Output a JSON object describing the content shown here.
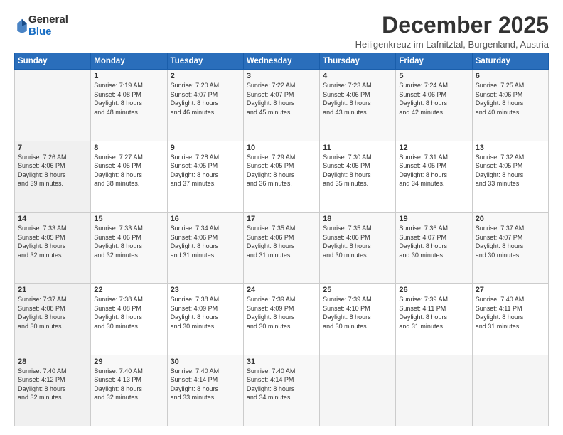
{
  "logo": {
    "general": "General",
    "blue": "Blue"
  },
  "header": {
    "month": "December 2025",
    "location": "Heiligenkreuz im Lafnitztal, Burgenland, Austria"
  },
  "weekdays": [
    "Sunday",
    "Monday",
    "Tuesday",
    "Wednesday",
    "Thursday",
    "Friday",
    "Saturday"
  ],
  "weeks": [
    [
      {
        "day": "",
        "info": ""
      },
      {
        "day": "1",
        "info": "Sunrise: 7:19 AM\nSunset: 4:08 PM\nDaylight: 8 hours\nand 48 minutes."
      },
      {
        "day": "2",
        "info": "Sunrise: 7:20 AM\nSunset: 4:07 PM\nDaylight: 8 hours\nand 46 minutes."
      },
      {
        "day": "3",
        "info": "Sunrise: 7:22 AM\nSunset: 4:07 PM\nDaylight: 8 hours\nand 45 minutes."
      },
      {
        "day": "4",
        "info": "Sunrise: 7:23 AM\nSunset: 4:06 PM\nDaylight: 8 hours\nand 43 minutes."
      },
      {
        "day": "5",
        "info": "Sunrise: 7:24 AM\nSunset: 4:06 PM\nDaylight: 8 hours\nand 42 minutes."
      },
      {
        "day": "6",
        "info": "Sunrise: 7:25 AM\nSunset: 4:06 PM\nDaylight: 8 hours\nand 40 minutes."
      }
    ],
    [
      {
        "day": "7",
        "info": "Sunrise: 7:26 AM\nSunset: 4:06 PM\nDaylight: 8 hours\nand 39 minutes."
      },
      {
        "day": "8",
        "info": "Sunrise: 7:27 AM\nSunset: 4:05 PM\nDaylight: 8 hours\nand 38 minutes."
      },
      {
        "day": "9",
        "info": "Sunrise: 7:28 AM\nSunset: 4:05 PM\nDaylight: 8 hours\nand 37 minutes."
      },
      {
        "day": "10",
        "info": "Sunrise: 7:29 AM\nSunset: 4:05 PM\nDaylight: 8 hours\nand 36 minutes."
      },
      {
        "day": "11",
        "info": "Sunrise: 7:30 AM\nSunset: 4:05 PM\nDaylight: 8 hours\nand 35 minutes."
      },
      {
        "day": "12",
        "info": "Sunrise: 7:31 AM\nSunset: 4:05 PM\nDaylight: 8 hours\nand 34 minutes."
      },
      {
        "day": "13",
        "info": "Sunrise: 7:32 AM\nSunset: 4:05 PM\nDaylight: 8 hours\nand 33 minutes."
      }
    ],
    [
      {
        "day": "14",
        "info": "Sunrise: 7:33 AM\nSunset: 4:05 PM\nDaylight: 8 hours\nand 32 minutes."
      },
      {
        "day": "15",
        "info": "Sunrise: 7:33 AM\nSunset: 4:06 PM\nDaylight: 8 hours\nand 32 minutes."
      },
      {
        "day": "16",
        "info": "Sunrise: 7:34 AM\nSunset: 4:06 PM\nDaylight: 8 hours\nand 31 minutes."
      },
      {
        "day": "17",
        "info": "Sunrise: 7:35 AM\nSunset: 4:06 PM\nDaylight: 8 hours\nand 31 minutes."
      },
      {
        "day": "18",
        "info": "Sunrise: 7:35 AM\nSunset: 4:06 PM\nDaylight: 8 hours\nand 30 minutes."
      },
      {
        "day": "19",
        "info": "Sunrise: 7:36 AM\nSunset: 4:07 PM\nDaylight: 8 hours\nand 30 minutes."
      },
      {
        "day": "20",
        "info": "Sunrise: 7:37 AM\nSunset: 4:07 PM\nDaylight: 8 hours\nand 30 minutes."
      }
    ],
    [
      {
        "day": "21",
        "info": "Sunrise: 7:37 AM\nSunset: 4:08 PM\nDaylight: 8 hours\nand 30 minutes."
      },
      {
        "day": "22",
        "info": "Sunrise: 7:38 AM\nSunset: 4:08 PM\nDaylight: 8 hours\nand 30 minutes."
      },
      {
        "day": "23",
        "info": "Sunrise: 7:38 AM\nSunset: 4:09 PM\nDaylight: 8 hours\nand 30 minutes."
      },
      {
        "day": "24",
        "info": "Sunrise: 7:39 AM\nSunset: 4:09 PM\nDaylight: 8 hours\nand 30 minutes."
      },
      {
        "day": "25",
        "info": "Sunrise: 7:39 AM\nSunset: 4:10 PM\nDaylight: 8 hours\nand 30 minutes."
      },
      {
        "day": "26",
        "info": "Sunrise: 7:39 AM\nSunset: 4:11 PM\nDaylight: 8 hours\nand 31 minutes."
      },
      {
        "day": "27",
        "info": "Sunrise: 7:40 AM\nSunset: 4:11 PM\nDaylight: 8 hours\nand 31 minutes."
      }
    ],
    [
      {
        "day": "28",
        "info": "Sunrise: 7:40 AM\nSunset: 4:12 PM\nDaylight: 8 hours\nand 32 minutes."
      },
      {
        "day": "29",
        "info": "Sunrise: 7:40 AM\nSunset: 4:13 PM\nDaylight: 8 hours\nand 32 minutes."
      },
      {
        "day": "30",
        "info": "Sunrise: 7:40 AM\nSunset: 4:14 PM\nDaylight: 8 hours\nand 33 minutes."
      },
      {
        "day": "31",
        "info": "Sunrise: 7:40 AM\nSunset: 4:14 PM\nDaylight: 8 hours\nand 34 minutes."
      },
      {
        "day": "",
        "info": ""
      },
      {
        "day": "",
        "info": ""
      },
      {
        "day": "",
        "info": ""
      }
    ]
  ]
}
